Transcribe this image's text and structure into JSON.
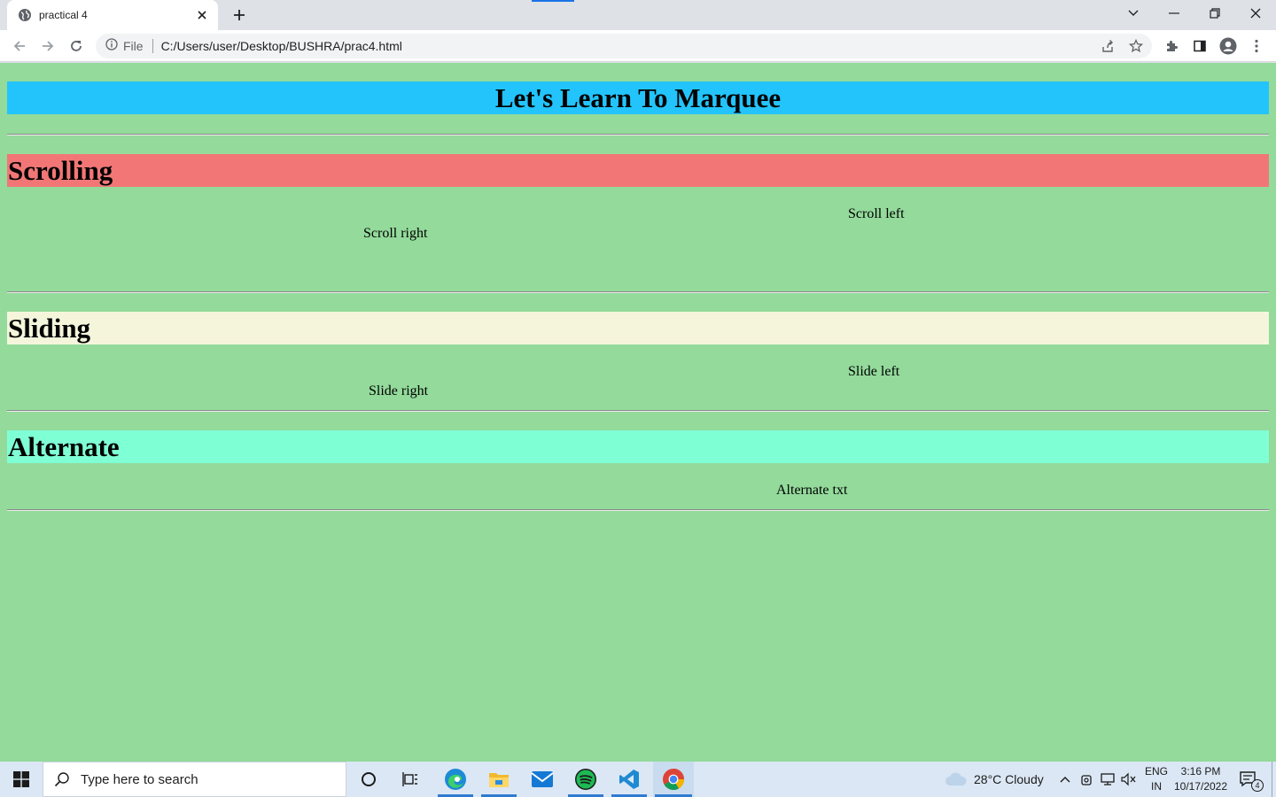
{
  "browser": {
    "tab_title": "practical 4",
    "site_label": "File",
    "url": "C:/Users/user/Desktop/BUSHRA/prac4.html"
  },
  "page": {
    "heading": "Let's Learn To Marquee",
    "sections": [
      {
        "title": "Scrolling",
        "color": "#f37676"
      },
      {
        "title": "Sliding",
        "color": "#f5f5dc"
      },
      {
        "title": "Alternate",
        "color": "#7fffd4"
      }
    ],
    "marquees": {
      "scroll_left": "Scroll left",
      "scroll_right": "Scroll right",
      "slide_left": "Slide left",
      "slide_right": "Slide right",
      "alternate": "Alternate txt"
    },
    "colors": {
      "background": "#93da9b",
      "heading_band": "#22c4fb"
    }
  },
  "taskbar": {
    "search_placeholder": "Type here to search",
    "weather": "28°C  Cloudy",
    "lang_top": "ENG",
    "lang_bottom": "IN",
    "time": "3:16 PM",
    "date": "10/17/2022",
    "notification_count": "4",
    "apps": [
      "cortana-icon",
      "task-view-icon",
      "edge-icon",
      "file-explorer-icon",
      "mail-icon",
      "spotify-icon",
      "vscode-icon",
      "chrome-icon"
    ]
  }
}
